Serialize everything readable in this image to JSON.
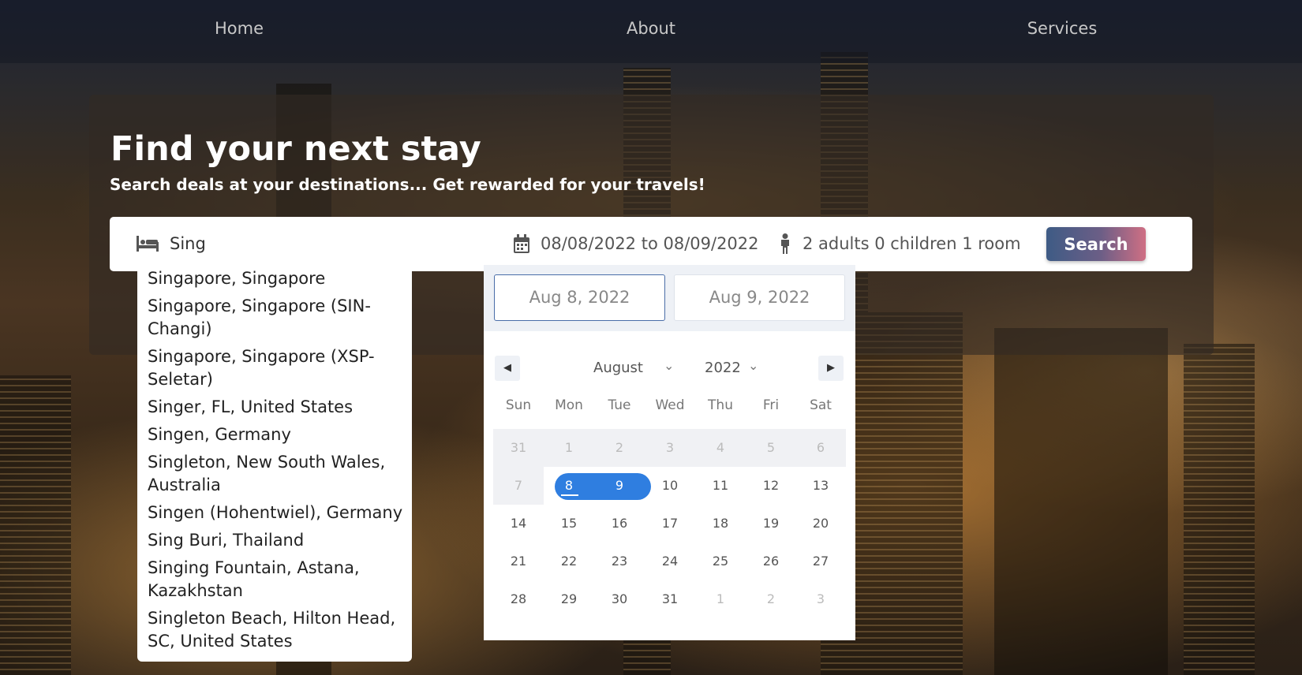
{
  "nav": {
    "home": "Home",
    "about": "About",
    "services": "Services"
  },
  "hero": {
    "title": "Find your next stay",
    "subtitle": "Search deals at your destinations... Get rewarded for your travels!"
  },
  "search": {
    "destination_value": "Sing",
    "dates": "08/08/2022 to 08/09/2022",
    "guests": "2 adults 0 children 1 room",
    "button_label": "Search"
  },
  "suggestions": [
    "Singapore, Singapore",
    "Singapore, Singapore (SIN-Changi)",
    "Singapore, Singapore (XSP-Seletar)",
    "Singer, FL, United States",
    "Singen, Germany",
    "Singleton, New South Wales, Australia",
    "Singen (Hohentwiel), Germany",
    "Sing Buri, Thailand",
    "Singing Fountain, Astana, Kazakhstan",
    "Singleton Beach, Hilton Head, SC, United States"
  ],
  "datepicker": {
    "start_input": "Aug 8, 2022",
    "end_input": "Aug 9, 2022",
    "month": "August",
    "year": "2022",
    "weekdays": [
      "Sun",
      "Mon",
      "Tue",
      "Wed",
      "Thu",
      "Fri",
      "Sat"
    ],
    "weeks": [
      [
        "31",
        "1",
        "2",
        "3",
        "4",
        "5",
        "6"
      ],
      [
        "7",
        "8",
        "9",
        "10",
        "11",
        "12",
        "13"
      ],
      [
        "14",
        "15",
        "16",
        "17",
        "18",
        "19",
        "20"
      ],
      [
        "21",
        "22",
        "23",
        "24",
        "25",
        "26",
        "27"
      ],
      [
        "28",
        "29",
        "30",
        "31",
        "1",
        "2",
        "3"
      ]
    ]
  },
  "colors": {
    "accent": "#2f7ee0",
    "button_gradient_start": "#3e5b85",
    "button_gradient_end": "#cf6f84"
  }
}
